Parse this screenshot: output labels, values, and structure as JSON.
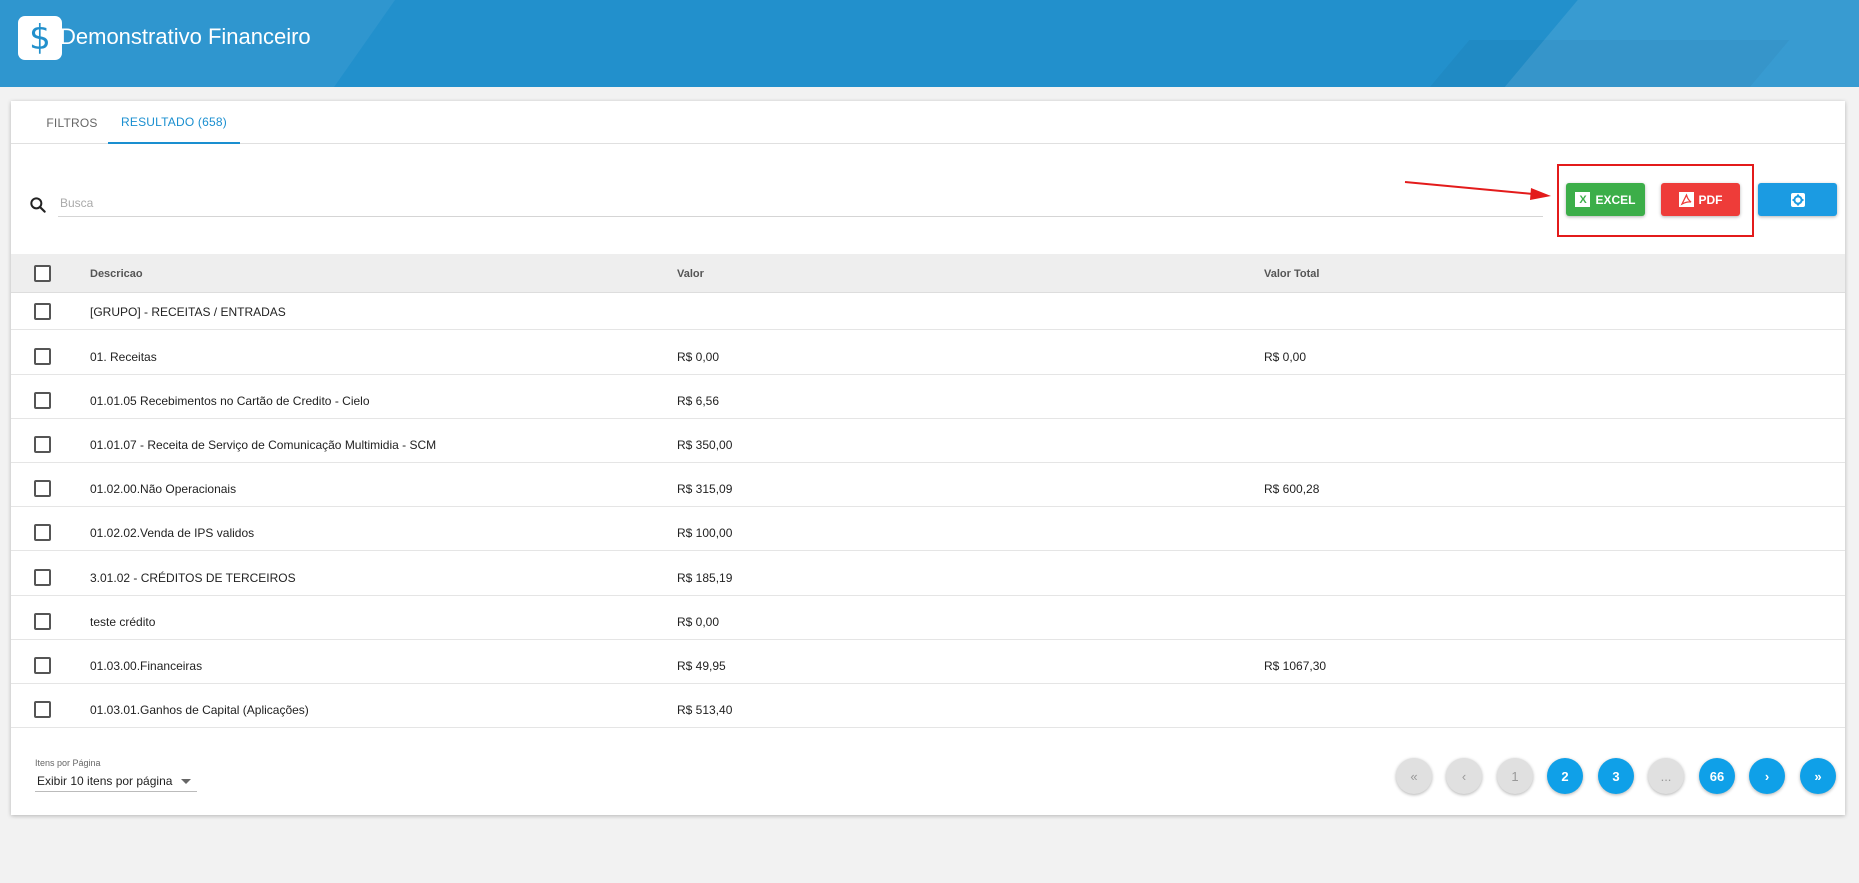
{
  "app": {
    "title": "Demonstrativo Financeiro",
    "logo_glyph": "$",
    "logo_icon": "dollar-icon"
  },
  "tabs": [
    {
      "label": "FILTROS",
      "active": false
    },
    {
      "label": "RESULTADO (658)",
      "active": true
    }
  ],
  "search": {
    "placeholder": "Busca",
    "value": ""
  },
  "toolbar": {
    "excel_label": "EXCEL",
    "excel_icon": "X",
    "pdf_label": "PDF",
    "settings_icon": "gear-icon"
  },
  "colors": {
    "header": "#2290cc",
    "accent": "#1a8fd0",
    "excel": "#3cae49",
    "pdf": "#ee3c39",
    "settings": "#1b9be2",
    "annotation": "#e31b1b"
  },
  "table": {
    "columns": [
      "Descricao",
      "Valor",
      "Valor Total"
    ],
    "rows": [
      {
        "descricao": "[GRUPO] - RECEITAS / ENTRADAS",
        "valor": "",
        "total": ""
      },
      {
        "descricao": "01. Receitas",
        "valor": "R$ 0,00",
        "total": "R$ 0,00"
      },
      {
        "descricao": "01.01.05 Recebimentos no Cartão de Credito - Cielo",
        "valor": "R$ 6,56",
        "total": ""
      },
      {
        "descricao": "01.01.07 - Receita de Serviço de Comunicação Multimidia - SCM",
        "valor": "R$ 350,00",
        "total": ""
      },
      {
        "descricao": "01.02.00.Não Operacionais",
        "valor": "R$ 315,09",
        "total": "R$ 600,28"
      },
      {
        "descricao": "01.02.02.Venda de IPS validos",
        "valor": "R$ 100,00",
        "total": ""
      },
      {
        "descricao": "3.01.02 - CRÉDITOS DE TERCEIROS",
        "valor": "R$ 185,19",
        "total": ""
      },
      {
        "descricao": "teste crédito",
        "valor": "R$ 0,00",
        "total": ""
      },
      {
        "descricao": "01.03.00.Financeiras",
        "valor": "R$ 49,95",
        "total": "R$ 1067,30"
      },
      {
        "descricao": "01.03.01.Ganhos de Capital (Aplicações)",
        "valor": "R$ 513,40",
        "total": ""
      }
    ]
  },
  "footer": {
    "items_per_page_label": "Itens por Página",
    "items_per_page_value": "Exibir 10 itens por página",
    "pagination": {
      "first": "«",
      "prev": "‹",
      "pages": [
        "1",
        "2",
        "3",
        "...",
        "66"
      ],
      "current": "1",
      "next": "›",
      "last": "»"
    }
  }
}
